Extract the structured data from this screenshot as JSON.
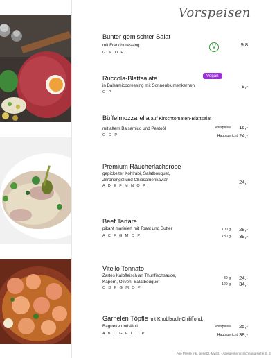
{
  "header": {
    "title": "Vorspeisen"
  },
  "items": [
    {
      "name": "Bunter gemischter Salat",
      "desc": [
        "mit Frenchdressing"
      ],
      "codes": "G M O P",
      "badge_icon": "vegetarian-v-icon",
      "badge_letter": "V",
      "prices": [
        {
          "label": "",
          "price": "9,8"
        }
      ]
    },
    {
      "name": "Ruccola-Blattsalate",
      "desc": [
        "in Balsamicodressing mit Sonnenblumenkernen"
      ],
      "codes": "O P",
      "badge": "Vegan",
      "prices": [
        {
          "label": "",
          "price": "9,-"
        }
      ]
    },
    {
      "name": "Büffelmozzarella",
      "name_small": " auf Kirschtomaten-Blattsalat",
      "desc": [
        "mit altem Balsamico und Pestoöl"
      ],
      "codes": "G O P",
      "prices": [
        {
          "label": "Vorspeise",
          "price": "16,-"
        },
        {
          "label": "Hauptgericht",
          "price": "24,-"
        }
      ]
    },
    {
      "name": "Premium Räucherlachsrose",
      "desc": [
        "gepickelter Kohlrabi, Salatbouquet,",
        "Zitronengel und Chiasamenkaviar"
      ],
      "codes": "A D E F M N O P",
      "prices": [
        {
          "label": "",
          "price": "24,-"
        }
      ]
    },
    {
      "name": "Beef Tartare",
      "desc": [
        "pikant mariniert mit Toast und Butter"
      ],
      "codes": "A C F G M O P",
      "prices": [
        {
          "label": "100 g",
          "price": "28,-"
        },
        {
          "label": "180 g",
          "price": "39,-"
        }
      ]
    },
    {
      "name": "Vitello Tonnato",
      "desc": [
        "Zartes Kalbfleisch an Thunfischsauce,",
        "Kapern, Oliven, Salatbouquet"
      ],
      "codes": "C D F G M O P",
      "prices": [
        {
          "label": "80 g",
          "price": "24,-"
        },
        {
          "label": "120 g",
          "price": "34,-"
        }
      ]
    },
    {
      "name": "Garnelen Töpfle",
      "name_small": " mit Knoblauch-Chiliffond,",
      "desc": [
        "Baguette und Aioli"
      ],
      "codes": "A B C G F L O P",
      "prices": [
        {
          "label": "Vorspeise",
          "price": "25,-"
        },
        {
          "label": "Hauptgericht",
          "price": "38,-"
        }
      ]
    }
  ],
  "footer": {
    "note": "Alle Preise inkl. gesetzl. MwSt. · Allergenkennzeichnung siehe S. 2"
  },
  "colors": {
    "vegan_badge": "#9b2fd6",
    "vegetarian_icon": "#2e9b2e"
  }
}
